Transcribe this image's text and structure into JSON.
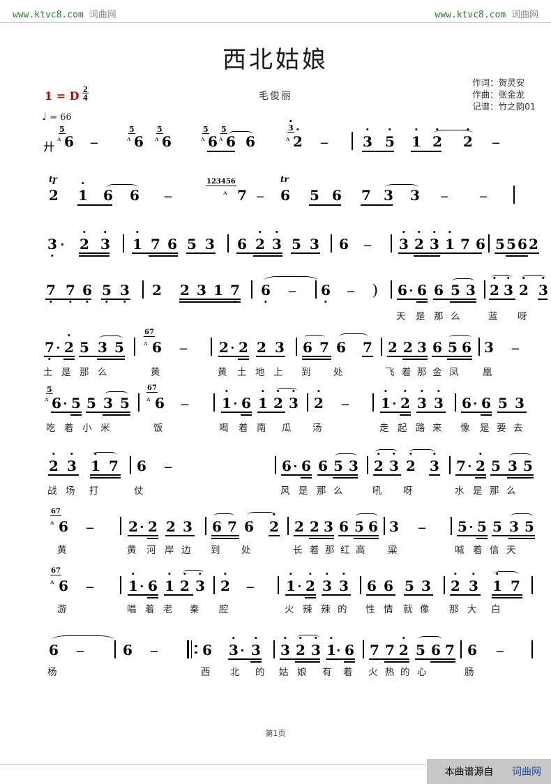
{
  "watermark": {
    "left_eng": "www.ktvc8.com",
    "left_cn": "词曲网",
    "right_eng": "www.ktvc8.com",
    "right_cn": "词曲网"
  },
  "header": {
    "title": "西北姑娘",
    "singer": "毛俊丽",
    "lyricist_label": "作词：贺灵安",
    "composer_label": "作曲：张金龙",
    "transcriber_label": "记谱：竹之韵01",
    "key_signature": "1 = D",
    "meter_numerator": "2",
    "meter_denominator": "4",
    "tempo": "= 66",
    "tempo_note_glyph": "♩",
    "key_color": "#c00000"
  },
  "footer": {
    "page_number": "第1页",
    "source_prefix": "本曲谱源自",
    "source_site": "词曲网"
  },
  "chart_data": {
    "type": "table",
    "title": "西北姑娘 — 简谱 (jianpu numbered notation)",
    "notation": "Chinese numbered musical notation",
    "key": "1 = D",
    "time_signature": "2/4",
    "tempo_bpm": 66,
    "systems": [
      {
        "index": 1,
        "notes": "6 - 6 6 6 6 6 | 2 - | 3 5 1 2 2 -",
        "ornaments": [
          "grace 5 before first 6",
          "grace 5",
          "grace 5",
          "grace 5",
          "grace 5",
          "slur over 6 6",
          "grace 3 before 2",
          "slur over 1 2 2"
        ],
        "lyrics": []
      },
      {
        "index": 2,
        "notes": "2 1 6 6 - 123456 7 - 6 5 6 7 3 3 - -",
        "ornaments": [
          "tr over 2",
          "slur over 6 6",
          "run 123456 grace",
          "tr over 6",
          "slur over 3 3"
        ],
        "lyrics": []
      },
      {
        "index": 3,
        "notes": "3. 2 3 | 1 7 6 5 3 | 6 2 3 5 3 | 6 - | 3 2 3 1 7 6 | 5 5 6 2 5 3 |",
        "ornaments": [],
        "lyrics": []
      },
      {
        "index": 4,
        "notes": "7 7 6 5 3 | 2 2 3 1 7 | 6 - 6 - ) | 6. 6 6 5 3 | 2 3 2 3 |",
        "ornaments": [
          "tie 6 to 6",
          "slur over 6 5 3",
          "slur over 2 3",
          "slur over 2 3"
        ],
        "lyrics": [
          "天",
          "是",
          "那",
          "么",
          "蓝",
          "呀"
        ]
      },
      {
        "index": 5,
        "notes": "7. 2 5 3 5 | 6 - | 2. 2 2 3 | 6 7 6 7 | 2 2 3 6 5 6 | 3 - |",
        "ornaments": [
          "slur over 3 5",
          "grace 67 before 6",
          "slur over 6 7",
          "slur over 5 6"
        ],
        "lyrics": [
          "土",
          "是",
          "那",
          "么",
          "黄",
          "黄",
          "土",
          "地",
          "上",
          "到",
          "处",
          "飞",
          "着",
          "那",
          "金",
          "凤",
          "凰"
        ]
      },
      {
        "index": 6,
        "notes": "6. 5 5 3 5 | 6 - | 1. 6 1 2 3 | 2 - | 1. 2 3 3 | 6. 6 5 3 |",
        "ornaments": [
          "grace 5 before 6",
          "slur over 3 5",
          "grace 67 before 6",
          "slur over 2 3"
        ],
        "lyrics": [
          "吃",
          "着",
          "小",
          "米",
          "饭",
          "喝",
          "着",
          "南",
          "瓜",
          "汤",
          "走",
          "起",
          "路",
          "来",
          "像",
          "是",
          "要",
          "去"
        ]
      },
      {
        "index": 7,
        "notes": "2 3 1 7 | 6 - | 6. 6 6 5 3 | 2 3 2 3 | 7. 2 5 3 5 |",
        "ornaments": [
          "slur over 1 7",
          "slur over 5 3",
          "slur over 2 3",
          "slur over 2 3",
          "slur over 3 5"
        ],
        "lyrics": [
          "战",
          "场",
          "打",
          "仗",
          "风",
          "是",
          "那",
          "么",
          "吼",
          "呀",
          "水",
          "是",
          "那",
          "么"
        ]
      },
      {
        "index": 8,
        "notes": "6 - | 2. 2 2 3 | 6 7 6 2 | 2 2 3 6 5 6 | 3 - | 5. 5 5 3 5 |",
        "ornaments": [
          "grace 67 before 6",
          "slur over 6 7",
          "slur over 6 2",
          "slur over 5 6",
          "slur over 3 5"
        ],
        "lyrics": [
          "黄",
          "黄",
          "河",
          "岸",
          "边",
          "到",
          "处",
          "长",
          "着",
          "那",
          "红",
          "高",
          "粱",
          "喊",
          "着",
          "信",
          "天"
        ]
      },
      {
        "index": 9,
        "notes": "6 - | 1. 6 1 2 3 | 2 - | 1. 2 3 3 | 6 6 5 3 | 2 3 1 7 |",
        "ornaments": [
          "grace 67 before 6",
          "slur over 2 3",
          "slur over 1 7"
        ],
        "lyrics": [
          "游",
          "唱",
          "着",
          "老",
          "秦",
          "腔",
          "火",
          "辣",
          "辣",
          "的",
          "性",
          "情",
          "就",
          "像",
          "那",
          "大",
          "白"
        ]
      },
      {
        "index": 10,
        "notes": "6 - | 6 - ||: 6 3. 3 | 3 2 3 1. 6 | 7 7 2 5 6 7 | 6 - |",
        "ornaments": [
          "tie 6 to 6",
          "repeat sign",
          "slur over 2 3",
          "slur over 5 6"
        ],
        "lyrics": [
          "杨",
          "西",
          "北",
          "的",
          "姑",
          "娘",
          "有",
          "着",
          "火",
          "热",
          "的",
          "心",
          "肠"
        ]
      }
    ]
  },
  "lyrics_lines": [
    "天是那么蓝呀 土是那么黄",
    "黄土地上到处飞着那金凤凰",
    "吃着小米饭 喝着南瓜汤",
    "走起路来像是要去战场打仗",
    "风是那么吼呀 水是那么黄",
    "黄河岸边到处长着那红高粱",
    "喊着信天游 唱着老秦腔",
    "火辣辣的性情就像那大白杨",
    "西北的姑娘有着火热的心肠"
  ]
}
